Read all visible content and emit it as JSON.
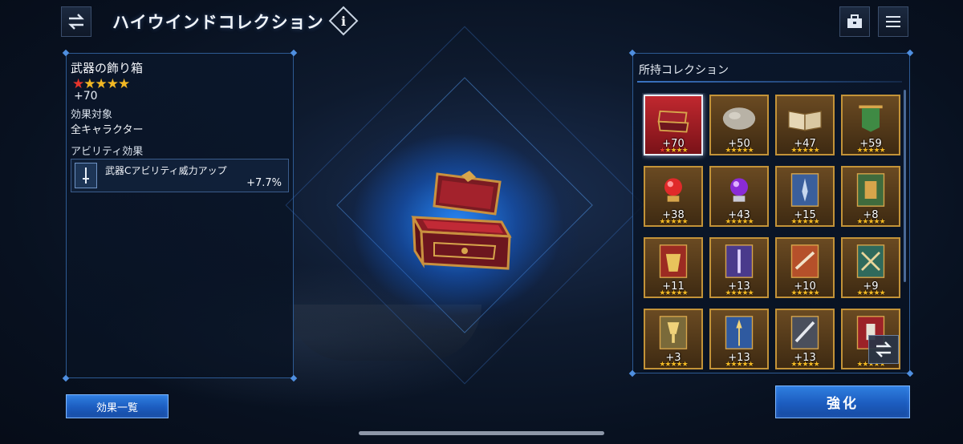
{
  "header": {
    "title": "ハイウインドコレクション",
    "info_label": "i"
  },
  "detail": {
    "item_name": "武器の飾り箱",
    "rarity_stars": 5,
    "red_stars": 1,
    "plus_level": "+70",
    "target_label": "効果対象",
    "target_value": "全キャラクター",
    "ability_label": "アビリティ効果",
    "ability": {
      "name": "武器Cアビリティ威力アップ",
      "value": "+7.7%"
    },
    "effects_button": "効果一覧"
  },
  "collection": {
    "title": "所持コレクション",
    "items": [
      {
        "plus": "+70",
        "art": "chest",
        "selected": true,
        "red_stars": 1
      },
      {
        "plus": "+50",
        "art": "rock",
        "selected": false,
        "red_stars": 0
      },
      {
        "plus": "+47",
        "art": "book",
        "selected": false,
        "red_stars": 0
      },
      {
        "plus": "+59",
        "art": "banner",
        "selected": false,
        "red_stars": 0
      },
      {
        "plus": "+38",
        "art": "red-orb",
        "selected": false,
        "red_stars": 0
      },
      {
        "plus": "+43",
        "art": "purple-orb",
        "selected": false,
        "red_stars": 0
      },
      {
        "plus": "+15",
        "art": "blue-card",
        "selected": false,
        "red_stars": 0
      },
      {
        "plus": "+8",
        "art": "green-card",
        "selected": false,
        "red_stars": 0
      },
      {
        "plus": "+11",
        "art": "gold-card",
        "selected": false,
        "red_stars": 0
      },
      {
        "plus": "+13",
        "art": "purple-card",
        "selected": false,
        "red_stars": 0
      },
      {
        "plus": "+10",
        "art": "orange-card",
        "selected": false,
        "red_stars": 0
      },
      {
        "plus": "+9",
        "art": "teal-card",
        "selected": false,
        "red_stars": 0
      },
      {
        "plus": "+3",
        "art": "gold-cup-card",
        "selected": false,
        "red_stars": 0
      },
      {
        "plus": "+13",
        "art": "blue-spear-card",
        "selected": false,
        "red_stars": 0
      },
      {
        "plus": "+13",
        "art": "silver-card",
        "selected": false,
        "red_stars": 0
      },
      {
        "plus": "",
        "art": "red-card",
        "selected": false,
        "red_stars": 0
      }
    ]
  },
  "enhance_button": "強化",
  "colors": {
    "accent_blue": "#1c5cbf",
    "panel_border": "#2d5a93",
    "tile_gold": "#c39338",
    "star_gold": "#f2b824",
    "star_red": "#e4342c"
  },
  "icons": {
    "top_left": "swap-arrows-icon",
    "top_right_1": "briefcase-icon",
    "top_right_2": "menu-icon",
    "info": "info-icon",
    "grid_overlay": "swap-arrows-icon"
  }
}
